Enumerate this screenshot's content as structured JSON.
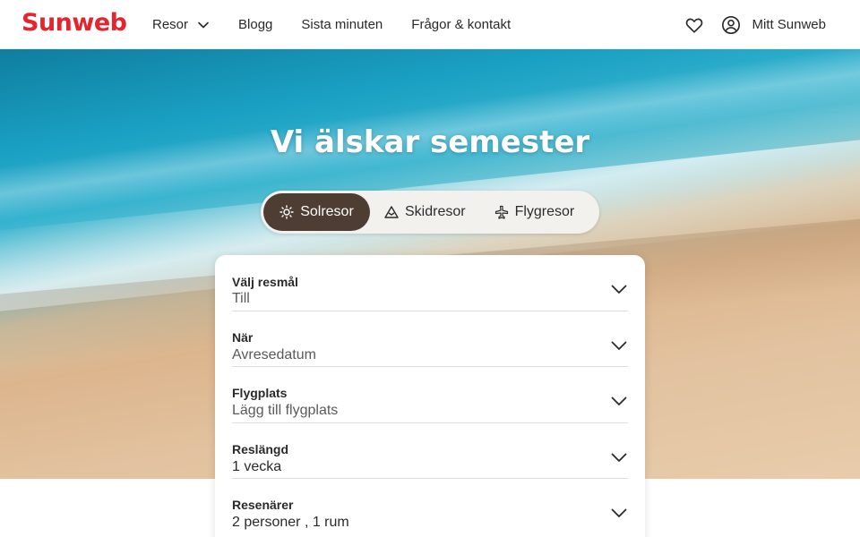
{
  "header": {
    "logo": "Sunweb",
    "nav": [
      {
        "label": "Resor",
        "has_dropdown": true
      },
      {
        "label": "Blogg"
      },
      {
        "label": "Sista minuten"
      },
      {
        "label": "Frågor & kontakt"
      }
    ],
    "favorites_icon": "heart-icon",
    "account_icon": "user-circle-icon",
    "account_label": "Mitt Sunweb"
  },
  "hero": {
    "title": "Vi älskar semester"
  },
  "tabs": [
    {
      "label": "Solresor",
      "icon": "sun-icon",
      "active": true
    },
    {
      "label": "Skidresor",
      "icon": "mountain-icon",
      "active": false
    },
    {
      "label": "Flygresor",
      "icon": "plane-icon",
      "active": false
    }
  ],
  "search": {
    "fields": [
      {
        "label": "Välj resmål",
        "value": "Till",
        "placeholder": true
      },
      {
        "label": "När",
        "value": "Avresedatum",
        "placeholder": true
      },
      {
        "label": "Flygplats",
        "value": "Lägg till flygplats",
        "placeholder": true
      },
      {
        "label": "Reslängd",
        "value": "1 vecka",
        "placeholder": false
      },
      {
        "label": "Resenärer",
        "value": "2 personer , 1 rum",
        "placeholder": false
      }
    ]
  },
  "colors": {
    "brand": "#e4242e",
    "active_tab": "#4e3d33"
  }
}
